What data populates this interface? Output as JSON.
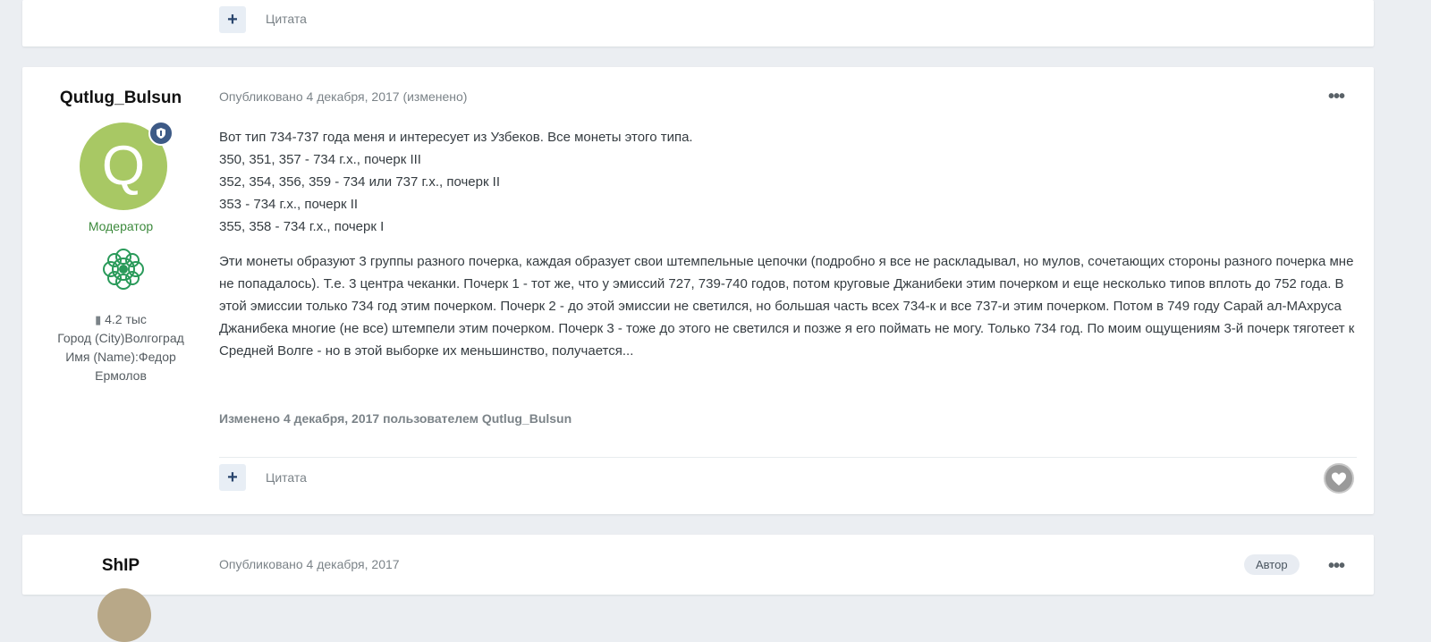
{
  "posts": [
    {
      "quote_label": "Цитата",
      "plus_label": "+"
    },
    {
      "author": "Qutlug_Bulsun",
      "avatar_letter": "Q",
      "published": "Опубликовано 4 декабря, 2017 (изменено)",
      "role": "Модератор",
      "posts_count": "4.2 тыс",
      "city": "Город (City)Волгоград",
      "name_line1": "Имя (Name):Федор",
      "name_line2": "Ермолов",
      "lines": [
        "Вот тип 734-737 года меня и интересует из Узбеков. Все монеты этого типа.",
        "350, 351, 357 - 734 г.х., почерк III",
        "352, 354, 356, 359 - 734 или 737 г.х., почерк II",
        "353 - 734 г.х., почерк II",
        "355, 358 - 734 г.х., почерк I"
      ],
      "paragraph": "Эти монеты образуют 3 группы разного почерка, каждая образует свои штемпельные цепочки (подробно я все не раскладывал, но мулов, сочетающих стороны разного почерка мне не попадалось). Т.е. 3 центра чеканки. Почерк 1 - тот же, что у эмиссий 727, 739-740 годов, потом круговые Джанибеки этим почерком и еще несколько типов вплоть до 752 года. В этой эмиссии только 734 год этим почерком. Почерк 2 - до этой эмиссии не светился, но большая часть всех 734-к и все 737-и этим почерком. Потом в 749 году Сарай ал-МАхруса Джанибека многие (не все) штемпели этим почерком. Почерк 3 - тоже до этого не светился и позже я его поймать не могу. Только 734 год. По моим ощущениям 3-й почерк тяготеет к Средней Волге - но в этой выборке их меньшинство, получается...",
      "edited": "Изменено 4 декабря, 2017 пользователем Qutlug_Bulsun",
      "quote_label": "Цитата",
      "plus_label": "+",
      "menu": "•••"
    },
    {
      "author": "ShIP",
      "published": "Опубликовано 4 декабря, 2017",
      "author_tag": "Автор",
      "menu": "•••"
    }
  ],
  "colors": {
    "background": "#ebeef2",
    "card": "#ffffff",
    "accent": "#29456d",
    "moderator": "#3d8a3d",
    "avatar": "#a8c864"
  }
}
